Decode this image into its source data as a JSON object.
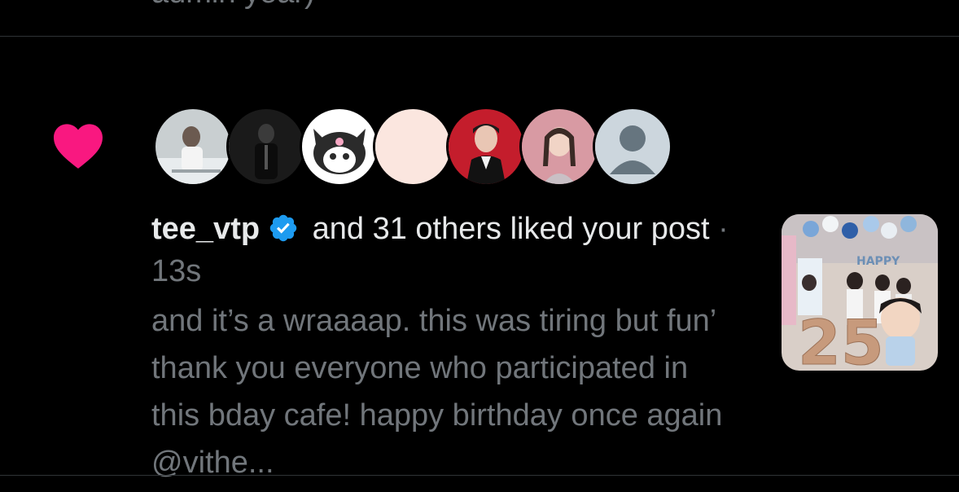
{
  "previous_item": {
    "text_fragment": "admin year)"
  },
  "notification": {
    "icon": "heart-icon",
    "icon_color": "#f91880",
    "avatars": [
      {
        "name": "avatar-1",
        "bg": "#c9cfd1"
      },
      {
        "name": "avatar-2",
        "bg": "#1a1a1a"
      },
      {
        "name": "avatar-3",
        "bg": "#ffffff"
      },
      {
        "name": "avatar-4",
        "bg": "#fbe6df"
      },
      {
        "name": "avatar-5",
        "bg": "#c41d2c"
      },
      {
        "name": "avatar-6",
        "bg": "#d89aa3"
      },
      {
        "name": "avatar-7",
        "bg": "#ccd6dd"
      }
    ],
    "username": "tee_vtp",
    "verified": true,
    "verified_color": "#1d9bf0",
    "action_text": " and 31 others liked your post",
    "separator": " · ",
    "timestamp": "13s",
    "post_preview": "and it’s a wraaaap. this was tiring but fun’ thank you everyone who participated in this bday cafe! happy birthday once again @vithe..."
  }
}
